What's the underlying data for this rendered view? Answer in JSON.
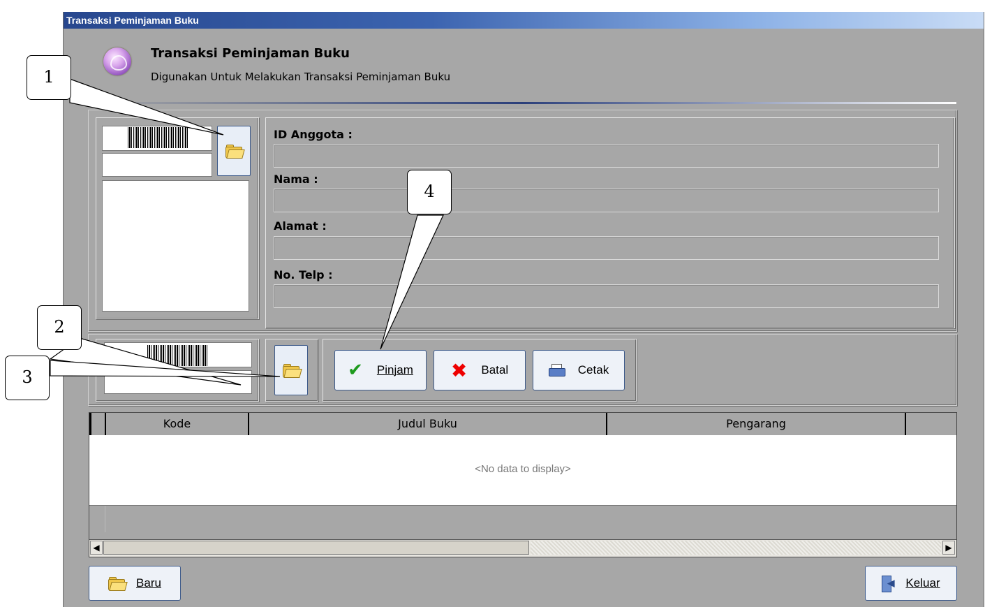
{
  "window": {
    "title": "Transaksi Peminjaman Buku"
  },
  "header": {
    "title": "Transaksi Peminjaman Buku",
    "subtitle": "Digunakan Untuk Melakukan Transaksi Peminjaman Buku"
  },
  "member": {
    "id_label": "ID Anggota :",
    "name_label": "Nama :",
    "address_label": "Alamat :",
    "phone_label": "No. Telp :"
  },
  "actions": {
    "pinjam_label": "Pinjam",
    "batal_label": "Batal",
    "cetak_label": "Cetak"
  },
  "table": {
    "columns": [
      "Kode",
      "Judul Buku",
      "Pengarang"
    ],
    "empty_text": "<No data to display>",
    "rows": []
  },
  "footer": {
    "baru_label": "Baru",
    "keluar_label": "Keluar"
  },
  "callouts": [
    "1",
    "2",
    "3",
    "4"
  ],
  "icons": {
    "logo": "app-logo-icon",
    "browse": "open-folder-icon",
    "pinjam": "checkmark-icon",
    "batal": "cross-icon",
    "cetak": "printer-icon",
    "baru": "new-folder-icon",
    "keluar": "exit-door-icon"
  }
}
